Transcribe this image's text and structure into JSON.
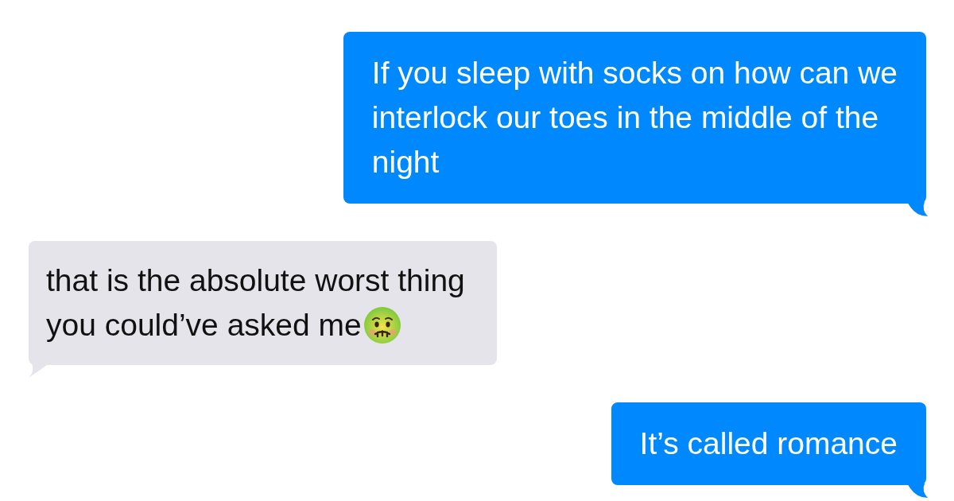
{
  "messages": [
    {
      "kind": "sent",
      "lines": [
        "If you sleep with socks on how can we",
        "interlock our toes in the middle of the",
        "night"
      ],
      "emoji": false
    },
    {
      "kind": "received",
      "lines": [
        "that is the absolute worst thing",
        "you could’ve asked me"
      ],
      "emoji": true
    },
    {
      "kind": "sent",
      "lines": [
        "It’s called romance"
      ],
      "emoji": false
    }
  ]
}
